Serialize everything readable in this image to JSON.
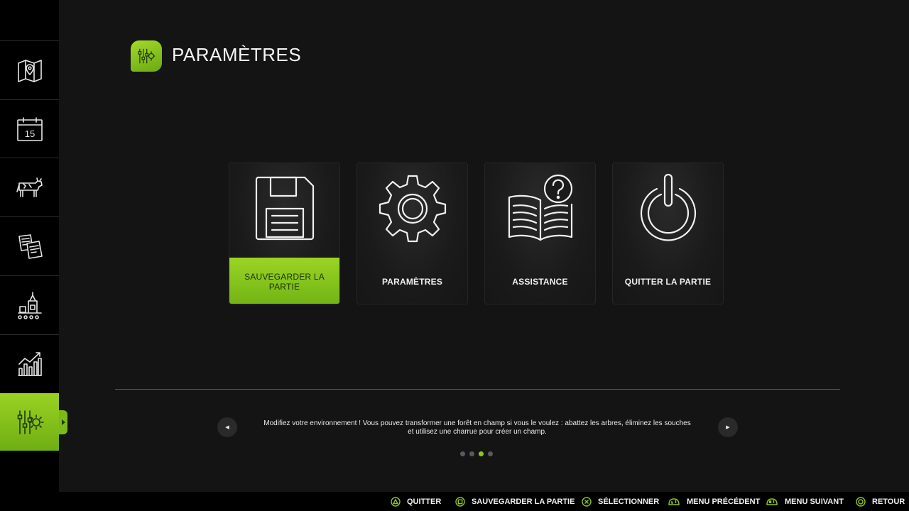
{
  "header": {
    "title": "PARAMÈTRES",
    "icon": "settings-sliders-gear-icon"
  },
  "sidebar": {
    "items": [
      {
        "name": "map",
        "icon": "map-icon"
      },
      {
        "name": "calendar",
        "icon": "calendar-icon",
        "badge": "15"
      },
      {
        "name": "animals",
        "icon": "cow-icon"
      },
      {
        "name": "contracts",
        "icon": "documents-icon"
      },
      {
        "name": "production",
        "icon": "factory-icon"
      },
      {
        "name": "statistics",
        "icon": "bar-chart-icon"
      },
      {
        "name": "settings",
        "icon": "settings-sliders-gear-icon",
        "active": true
      }
    ]
  },
  "menu": {
    "cards": [
      {
        "label": "SAUVEGARDER LA PARTIE",
        "icon": "floppy-disk-icon",
        "selected": true
      },
      {
        "label": "PARAMÈTRES",
        "icon": "gear-icon",
        "selected": false
      },
      {
        "label": "ASSISTANCE",
        "icon": "book-help-icon",
        "selected": false
      },
      {
        "label": "QUITTER LA PARTIE",
        "icon": "power-icon",
        "selected": false
      }
    ]
  },
  "tip": {
    "text": "Modifiez votre environnement ! Vous pouvez transformer une forêt en champ si vous le voulez : abattez les arbres, éliminez les souches et utilisez une charrue pour créer un champ.",
    "prev_icon": "◀",
    "next_icon": "▶",
    "page_count": 4,
    "current_page": 3
  },
  "bottom_bar": {
    "hints": [
      {
        "button": "triangle",
        "label": "QUITTER"
      },
      {
        "button": "square",
        "label": "SAUVEGARDER LA PARTIE"
      },
      {
        "button": "cross",
        "label": "SÉLECTIONNER"
      },
      {
        "button": "L1",
        "label": "MENU PRÉCÉDENT"
      },
      {
        "button": "R1",
        "label": "MENU SUIVANT"
      },
      {
        "button": "circle",
        "label": "RETOUR"
      }
    ]
  },
  "colors": {
    "accent": "#8cc61e",
    "accent_dark": "#1f3a05",
    "background": "#141414",
    "sidebar": "#000000"
  }
}
